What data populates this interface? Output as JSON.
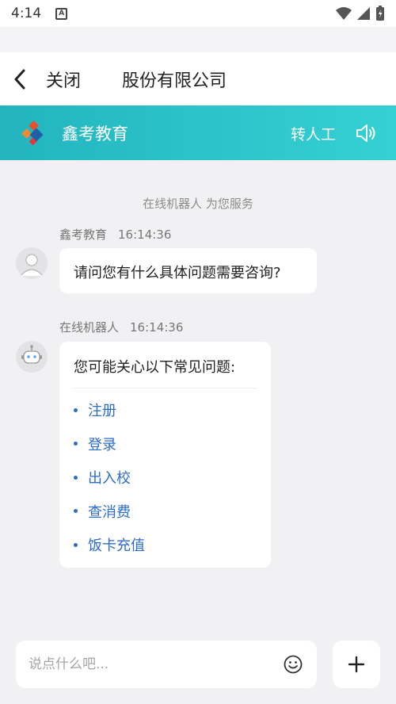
{
  "status_bar": {
    "time": "4:14",
    "notification_icon": "a-letter-icon"
  },
  "nav": {
    "close_label": "关闭",
    "title": "股份有限公司"
  },
  "chat_header": {
    "brand_name": "鑫考教育",
    "transfer_label": "转人工"
  },
  "chat": {
    "service_note": "在线机器人 为您服务",
    "messages": [
      {
        "sender": "鑫考教育",
        "time": "16:14:36",
        "text": "请问您有什么具体问题需要咨询?"
      },
      {
        "sender": "在线机器人",
        "time": "16:14:36",
        "text": "您可能关心以下常见问题:",
        "options": [
          "注册",
          "登录",
          "出入校",
          "查消费",
          "饭卡充值"
        ]
      }
    ]
  },
  "input": {
    "placeholder": "说点什么吧..."
  },
  "colors": {
    "header_start": "#23b4bf",
    "header_end": "#34d1d3",
    "link": "#2b6dc8",
    "background": "#f1f1f3"
  }
}
